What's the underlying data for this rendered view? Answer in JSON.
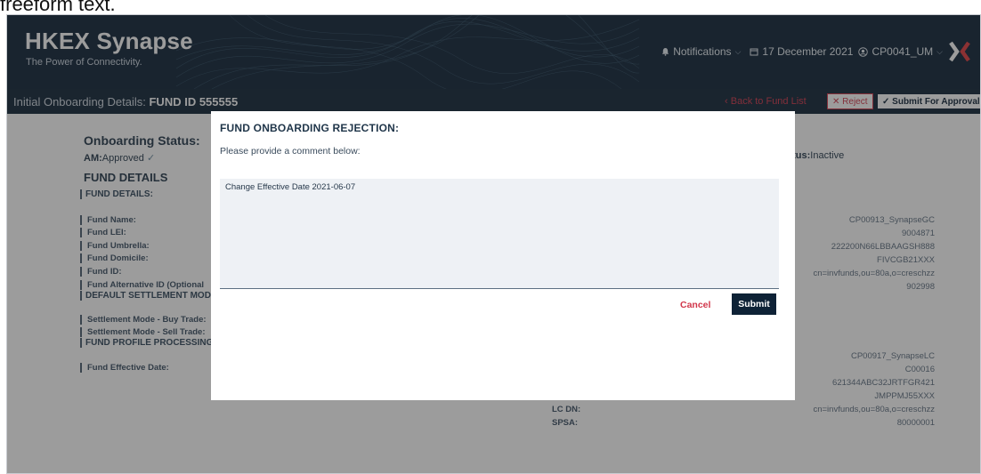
{
  "top_text": "freeform text.",
  "header": {
    "brand_title": "HKEX Synapse",
    "brand_subtitle": "The Power of Connectivity.",
    "notifications_label": "Notifications",
    "date": "17 December 2021",
    "user": "CP0041_UM"
  },
  "subbar": {
    "title_prefix": "Initial Onboarding Details:",
    "title_bold": "FUND ID 555555",
    "back_link": "Back to Fund List",
    "reject_label": "Reject",
    "submit_label": "Submit For Approval"
  },
  "left_panel": {
    "onboarding_status_label": "Onboarding Status:",
    "am_label": "AM:",
    "am_value": "Approved",
    "fund_details_heading": "FUND DETAILS",
    "fund_details_section": "FUND DETAILS:",
    "fields": [
      "Fund Name:",
      "Fund LEI:",
      "Fund Umbrella:",
      "Fund Domicile:",
      "Fund ID:",
      "Fund Alternative ID (Optional"
    ],
    "default_settlement": "DEFAULT SETTLEMENT MODE",
    "settlement_fields": [
      "Settlement Mode - Buy Trade:",
      "Settlement Mode - Sell Trade:"
    ],
    "profile_section": "FUND PROFILE PROCESSING",
    "effective_date_label": "Fund Effective Date:"
  },
  "right_panel": {
    "status_label": "atus:",
    "status_value": "Inactive",
    "fund_values": [
      "CP00913_SynapseGC",
      "9004871",
      "222200N66LBBAAGSH888",
      "FIVCGB21XXX",
      "cn=invfunds,ou=80a,o=creschzz",
      "902998"
    ],
    "lc_values": [
      "CP00917_SynapseLC",
      "C00016",
      "621344ABC32JRTFGR421",
      "JMPPMJ55XXX"
    ],
    "lc_dn_label": "LC DN:",
    "lc_dn_value": "cn=invfunds,ou=80a,o=creschzz",
    "spsa_label": "SPSA:",
    "spsa_value": "80000001"
  },
  "modal": {
    "title": "FUND ONBOARDING REJECTION:",
    "prompt": "Please provide a comment below:",
    "comment_value": "Change Effective Date 2021-06-07",
    "cancel_label": "Cancel",
    "submit_label": "Submit"
  },
  "colors": {
    "header_bg": "#0e2236",
    "accent_red": "#d1364a",
    "submit_bg": "#0e2236"
  },
  "icons": {
    "notifications": "bell-icon",
    "date": "calendar-icon",
    "user": "user-icon",
    "reject": "close-icon",
    "submit": "check-icon"
  }
}
